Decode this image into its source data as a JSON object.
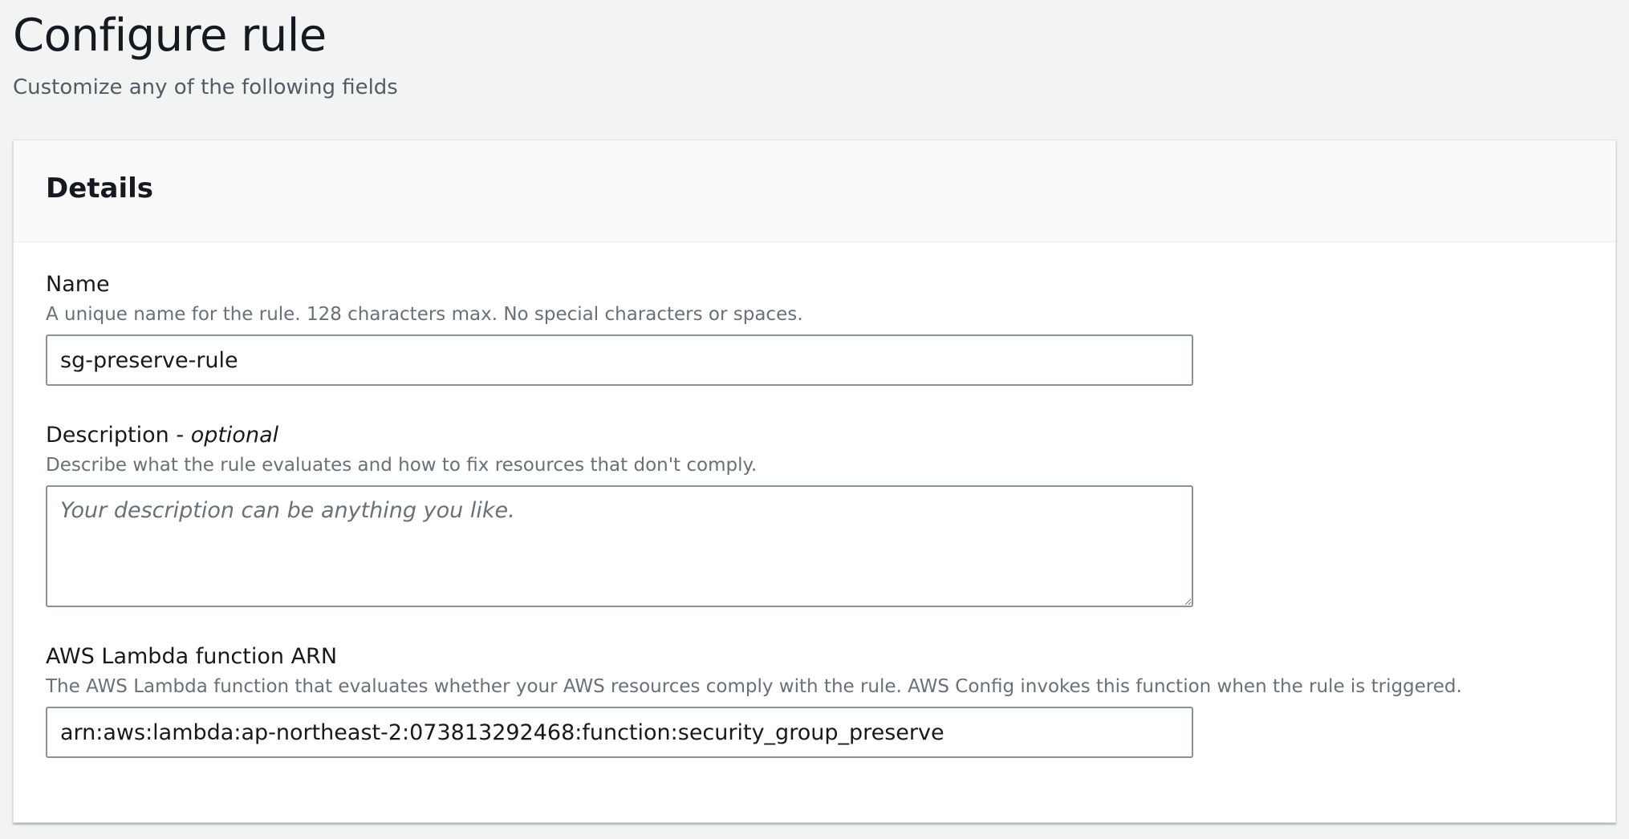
{
  "header": {
    "title": "Configure rule",
    "subtitle": "Customize any of the following fields"
  },
  "details": {
    "title": "Details",
    "name": {
      "label": "Name",
      "hint": "A unique name for the rule. 128 characters max. No special characters or spaces.",
      "value": "sg-preserve-rule"
    },
    "description": {
      "label": "Description - ",
      "label_optional": "optional",
      "hint": "Describe what the rule evaluates and how to fix resources that don't comply.",
      "placeholder": "Your description can be anything you like.",
      "value": ""
    },
    "lambda_arn": {
      "label": "AWS Lambda function ARN",
      "hint": "The AWS Lambda function that evaluates whether your AWS resources comply with the rule. AWS Config invokes this function when the rule is triggered.",
      "value": "arn:aws:lambda:ap-northeast-2:073813292468:function:security_group_preserve"
    }
  }
}
